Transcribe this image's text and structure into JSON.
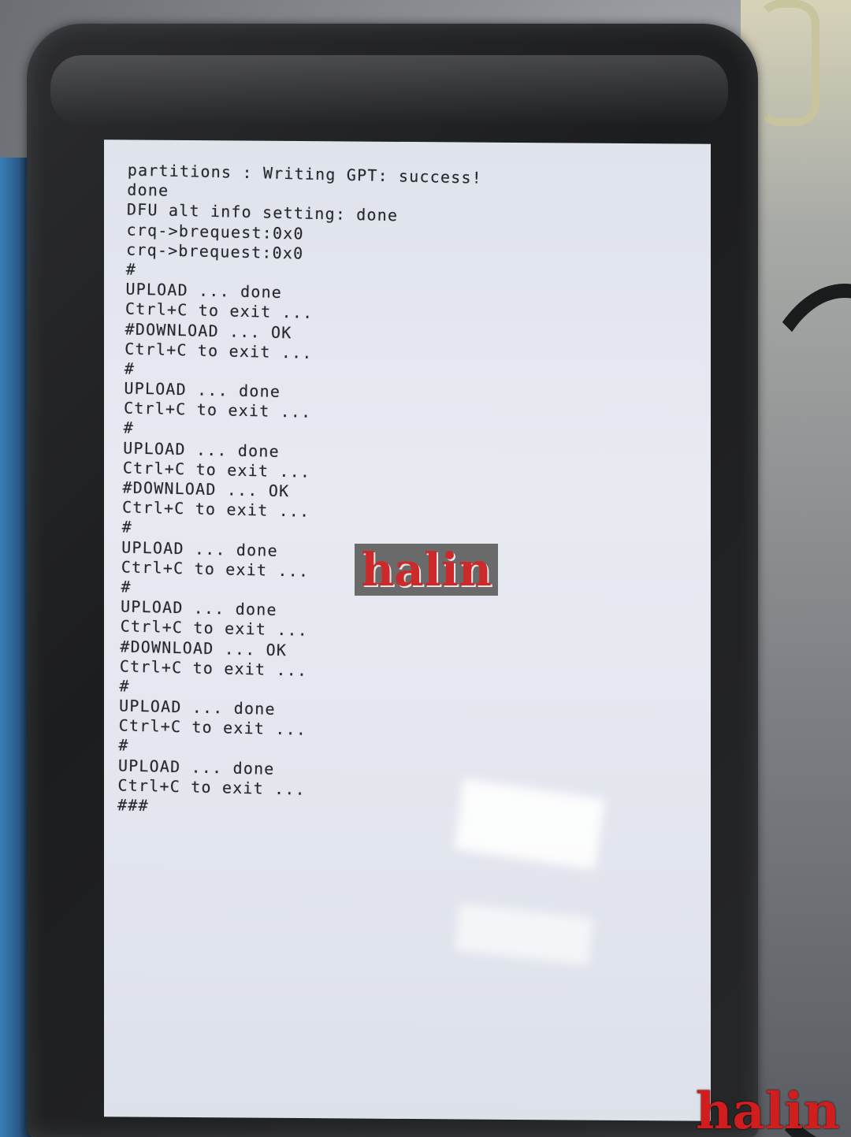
{
  "console": {
    "lines": [
      "partitions : Writing GPT: success!",
      "done",
      "DFU alt info setting: done",
      "crq->brequest:0x0",
      "crq->brequest:0x0",
      "#",
      "UPLOAD ... done",
      "Ctrl+C to exit ...",
      "#DOWNLOAD ... OK",
      "Ctrl+C to exit ...",
      "#",
      "UPLOAD ... done",
      "Ctrl+C to exit ...",
      "#",
      "UPLOAD ... done",
      "Ctrl+C to exit ...",
      "#DOWNLOAD ... OK",
      "Ctrl+C to exit ...",
      "#",
      "UPLOAD ... done",
      "Ctrl+C to exit ...",
      "#",
      "UPLOAD ... done",
      "Ctrl+C to exit ...",
      "#DOWNLOAD ... OK",
      "Ctrl+C to exit ...",
      "#",
      "UPLOAD ... done",
      "Ctrl+C to exit ...",
      "#",
      "UPLOAD ... done",
      "Ctrl+C to exit ...",
      "###"
    ]
  },
  "watermark": {
    "center": "halin",
    "corner": "halin"
  }
}
